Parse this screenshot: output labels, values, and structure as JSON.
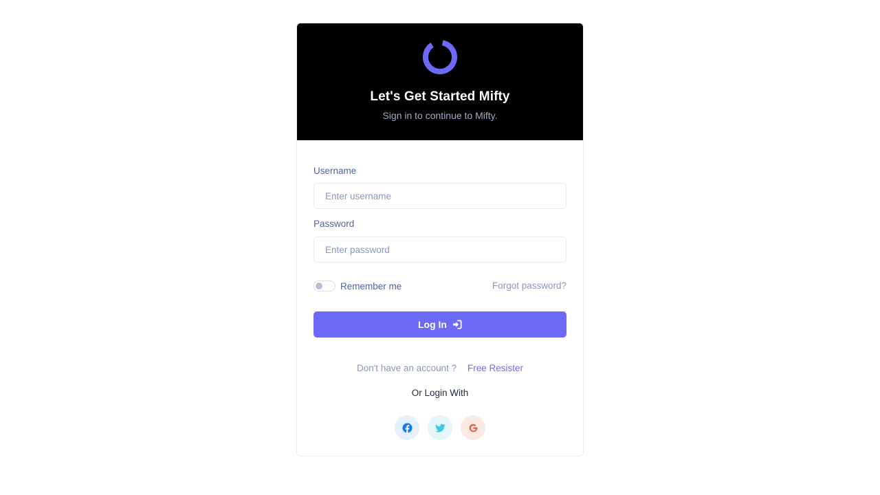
{
  "header": {
    "title": "Let's Get Started Mifty",
    "subtitle": "Sign in to continue to Mifty.",
    "logo_icon": "ring-logo-icon",
    "accent_color": "#6d6af7"
  },
  "form": {
    "username_label": "Username",
    "username_placeholder": "Enter username",
    "username_value": "",
    "password_label": "Password",
    "password_placeholder": "Enter password",
    "password_value": "",
    "remember_label": "Remember me",
    "remember_checked": false,
    "forgot_label": "Forgot password?",
    "login_label": "Log In",
    "login_icon": "sign-in-icon"
  },
  "footer": {
    "no_account_text": "Don't have an account ?",
    "register_link": "Free Resister",
    "or_login_text": "Or Login With",
    "social": [
      {
        "name": "facebook",
        "icon": "facebook-icon",
        "color": "#1877f2"
      },
      {
        "name": "twitter",
        "icon": "twitter-icon",
        "color": "#41c7df"
      },
      {
        "name": "google",
        "icon": "google-icon",
        "color": "#e4603b"
      }
    ]
  }
}
